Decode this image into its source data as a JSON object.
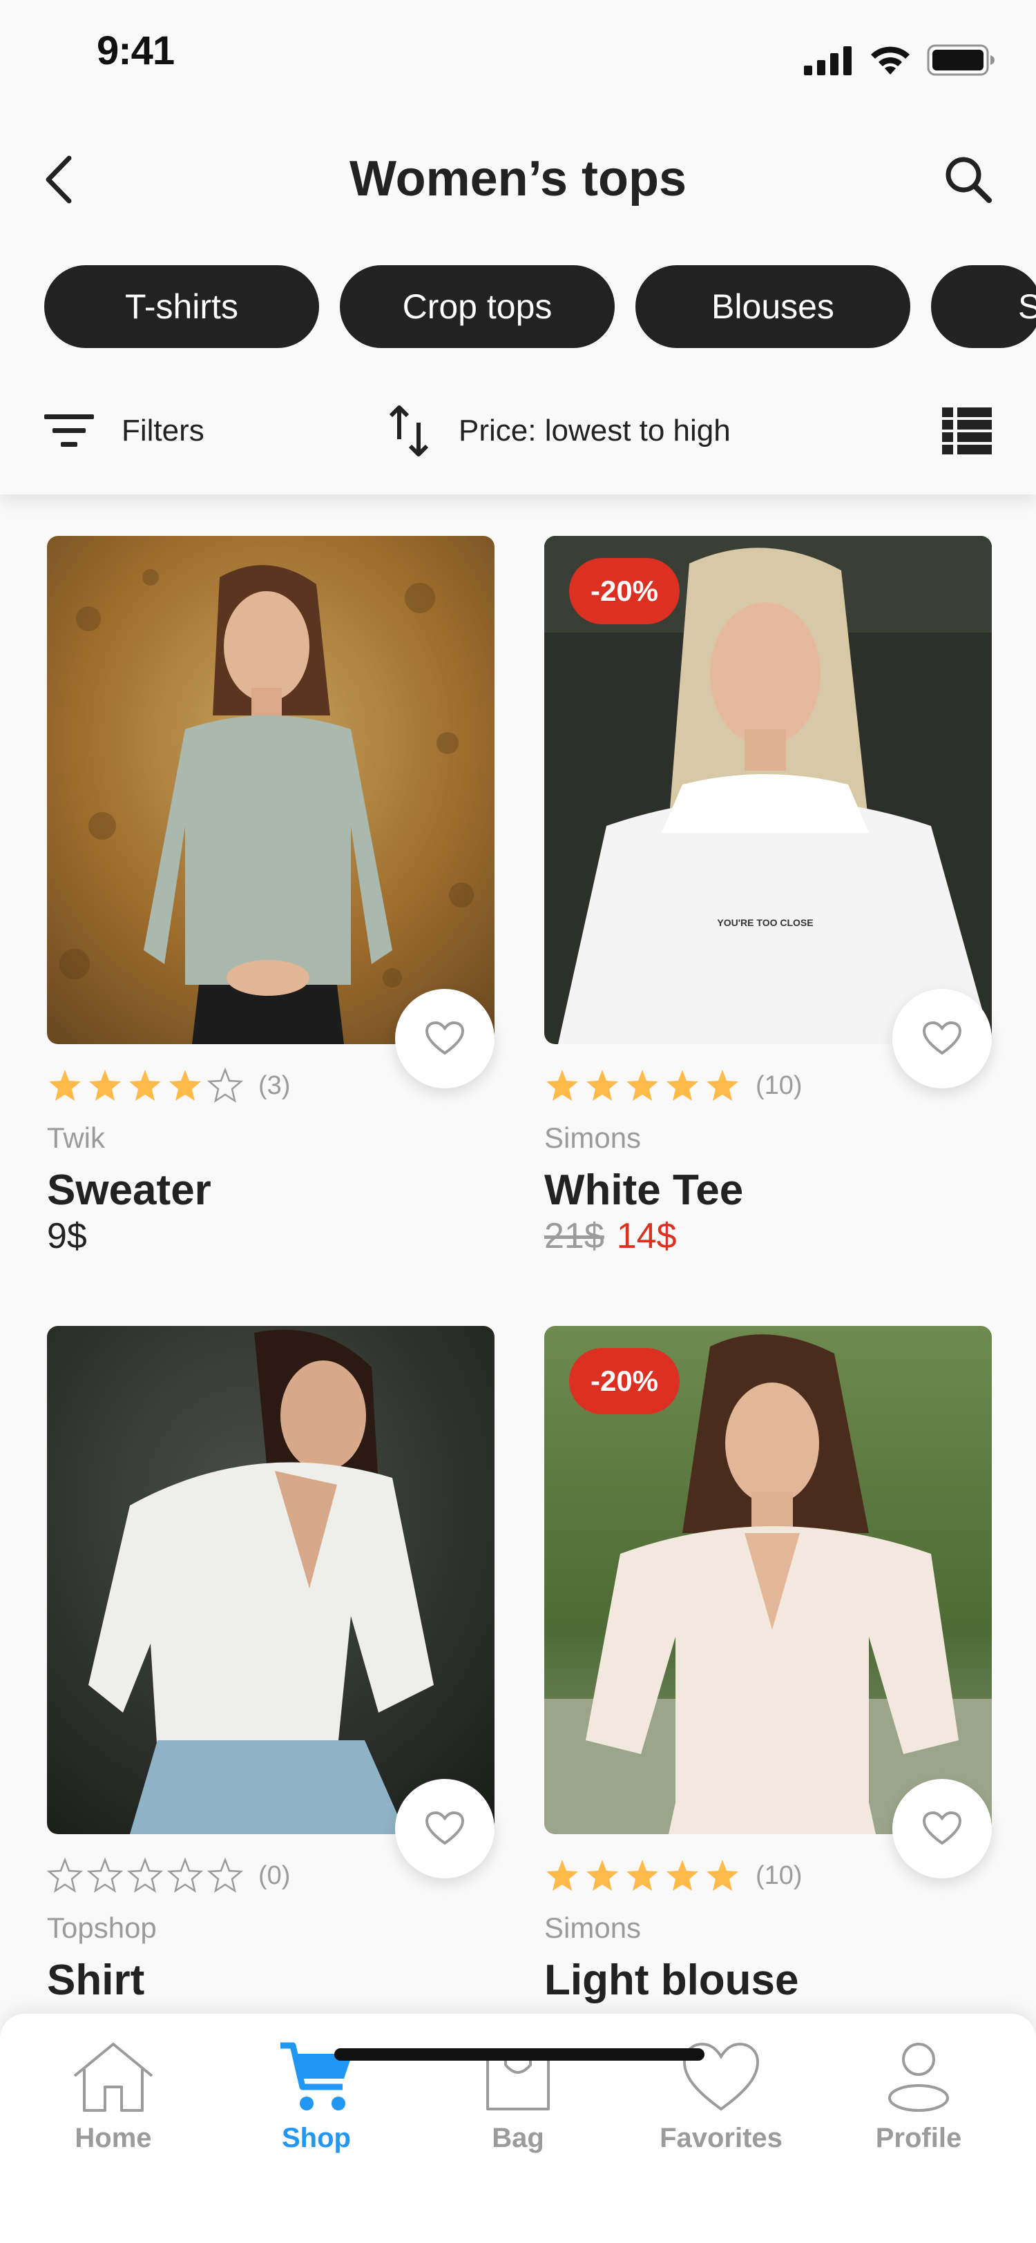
{
  "status_bar": {
    "time": "9:41"
  },
  "nav": {
    "title": "Women’s tops"
  },
  "categories": [
    "T-shirts",
    "Crop tops",
    "Blouses",
    "S"
  ],
  "toolbar": {
    "filters_label": "Filters",
    "sort_label": "Price: lowest to high"
  },
  "products": [
    {
      "brand": "Twik",
      "name": "Sweater",
      "price": "9$",
      "old_price": "",
      "new_price": "",
      "discount": "",
      "rating": 4,
      "reviews": "(3)"
    },
    {
      "brand": "Simons",
      "name": "White Tee",
      "price": "",
      "old_price": "21$",
      "new_price": "14$",
      "discount": "-20%",
      "rating": 5,
      "reviews": "(10)",
      "shirt_text": "YOU'RE TOO CLOSE"
    },
    {
      "brand": "Topshop",
      "name": "Shirt",
      "price": "",
      "old_price": "",
      "new_price": "",
      "discount": "",
      "rating": 0,
      "reviews": "(0)"
    },
    {
      "brand": "Simons",
      "name": "Light blouse",
      "price": "",
      "old_price": "",
      "new_price": "",
      "discount": "-20%",
      "rating": 5,
      "reviews": "(10)"
    }
  ],
  "tabbar": {
    "items": [
      {
        "label": "Home",
        "icon": "home-icon"
      },
      {
        "label": "Shop",
        "icon": "cart-icon"
      },
      {
        "label": "Bag",
        "icon": "bag-icon"
      },
      {
        "label": "Favorites",
        "icon": "heart-icon"
      },
      {
        "label": "Profile",
        "icon": "profile-icon"
      }
    ],
    "active": "Shop"
  },
  "colors": {
    "accent": "#2196f3",
    "sale": "#db3022",
    "dark": "#222222",
    "muted": "#9b9b9b",
    "star": "#ffba49"
  }
}
